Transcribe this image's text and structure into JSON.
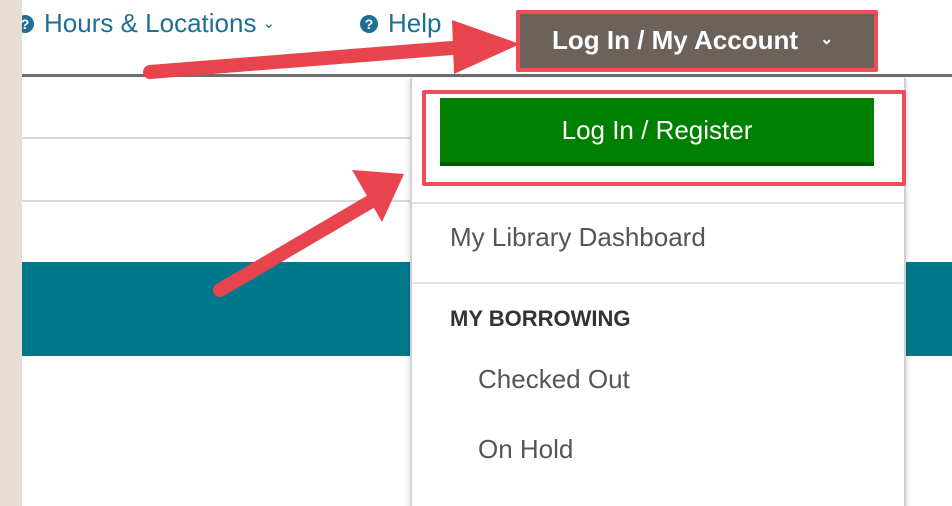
{
  "nav": {
    "hours_label": "Hours & Locations",
    "help_label": "Help"
  },
  "account": {
    "button_label": "Log In / My Account"
  },
  "dropdown": {
    "login_register_label": "Log In / Register",
    "dashboard_label": "My Library Dashboard",
    "section_heading": "MY BORROWING",
    "checked_out_label": "Checked Out",
    "on_hold_label": "On Hold"
  },
  "colors": {
    "link": "#1f6f95",
    "account_button": "#6b625c",
    "login_button": "#008000",
    "teal_band": "#00788c",
    "highlight": "#ef4d57",
    "backdrop": "#e6ddd3"
  },
  "icons": [
    "help-circle-icon",
    "chevron-down-icon",
    "arrow-annotation-icon"
  ]
}
